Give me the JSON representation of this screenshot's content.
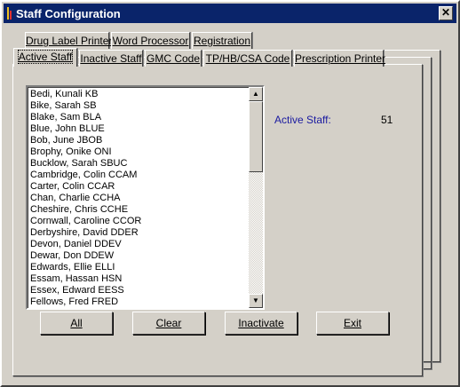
{
  "window": {
    "title": "Staff Configuration",
    "close_glyph": "✕"
  },
  "tabs_row1": [
    {
      "label": "Drug Label Printer"
    },
    {
      "label": "Word Processor"
    },
    {
      "label": "Registration"
    }
  ],
  "tabs_row2": [
    {
      "label": "Active Staff",
      "selected": true
    },
    {
      "label": "Inactive Staff"
    },
    {
      "label": "GMC Code"
    },
    {
      "label": "TP/HB/CSA Code"
    },
    {
      "label": "Prescription Printer"
    }
  ],
  "staff_list": [
    "Bedi, Kunali KB",
    "Bike, Sarah SB",
    "Blake, Sam BLA",
    "Blue, John BLUE",
    "Bob, June JBOB",
    "Brophy, Onike ONI",
    "Bucklow, Sarah SBUC",
    "Cambridge, Colin CCAM",
    "Carter, Colin CCAR",
    "Chan, Charlie CCHA",
    "Cheshire, Chris CCHE",
    "Cornwall, Caroline CCOR",
    "Derbyshire, David DDER",
    "Devon, Daniel DDEV",
    "Dewar, Don DDEW",
    "Edwards, Ellie ELLI",
    "Essam, Hassan HSN",
    "Essex, Edward EESS",
    "Fellows, Fred FRED"
  ],
  "summary": {
    "active_staff_label": "Active Staff:",
    "active_staff_count": "51"
  },
  "buttons": {
    "all": "All",
    "clear": "Clear",
    "inactivate": "Inactivate",
    "exit": "Exit"
  },
  "scrollbar": {
    "up_glyph": "▲",
    "down_glyph": "▼"
  },
  "colors": {
    "titlebar": "#0a246a",
    "label_blue": "#1a1aa0",
    "face": "#d4d0c8"
  }
}
